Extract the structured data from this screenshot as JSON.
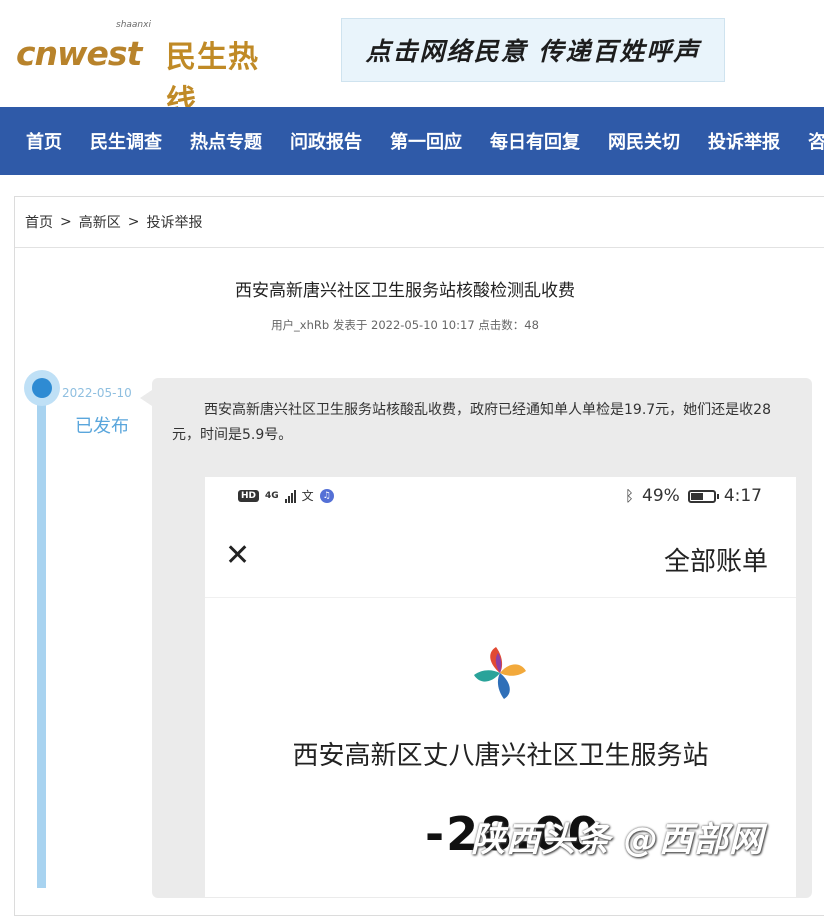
{
  "header": {
    "logo_en": "cnwest",
    "logo_en_small": "shaanxi",
    "logo_cn": "民生热线",
    "banner_text": "点击网络民意  传递百姓呼声"
  },
  "nav": {
    "items": [
      "首页",
      "民生调查",
      "热点专题",
      "问政报告",
      "第一回应",
      "每日有回复",
      "网民关切",
      "投诉举报",
      "咨"
    ]
  },
  "breadcrumb": {
    "items": [
      "首页",
      "高新区",
      "投诉举报"
    ],
    "separator": ">"
  },
  "post": {
    "title": "西安高新唐兴社区卫生服务站核酸检测乱收费",
    "meta": "用户_xhRb 发表于 2022-05-10 10:17 点击数：48"
  },
  "timeline": {
    "date": "2022-05-10",
    "status": "已发布"
  },
  "complaint": {
    "text": "西安高新唐兴社区卫生服务站核酸乱收费，政府已经通知单人单检是19.7元，她们还是收28元，时间是5.9号。"
  },
  "screenshot": {
    "status_left_hd": "HD",
    "status_left_net": "4G",
    "status_left_char": "文",
    "battery": "49%",
    "time": "4:17",
    "bill_title": "全部账单",
    "merchant": "西安高新区丈八唐兴社区卫生服务站",
    "amount": "-28.00"
  },
  "watermark": "陕西头条 @西部网",
  "colors": {
    "nav_bg": "#2f5aa8",
    "timeline_accent": "#2e8bd3",
    "bubble_bg": "#ebebeb"
  }
}
